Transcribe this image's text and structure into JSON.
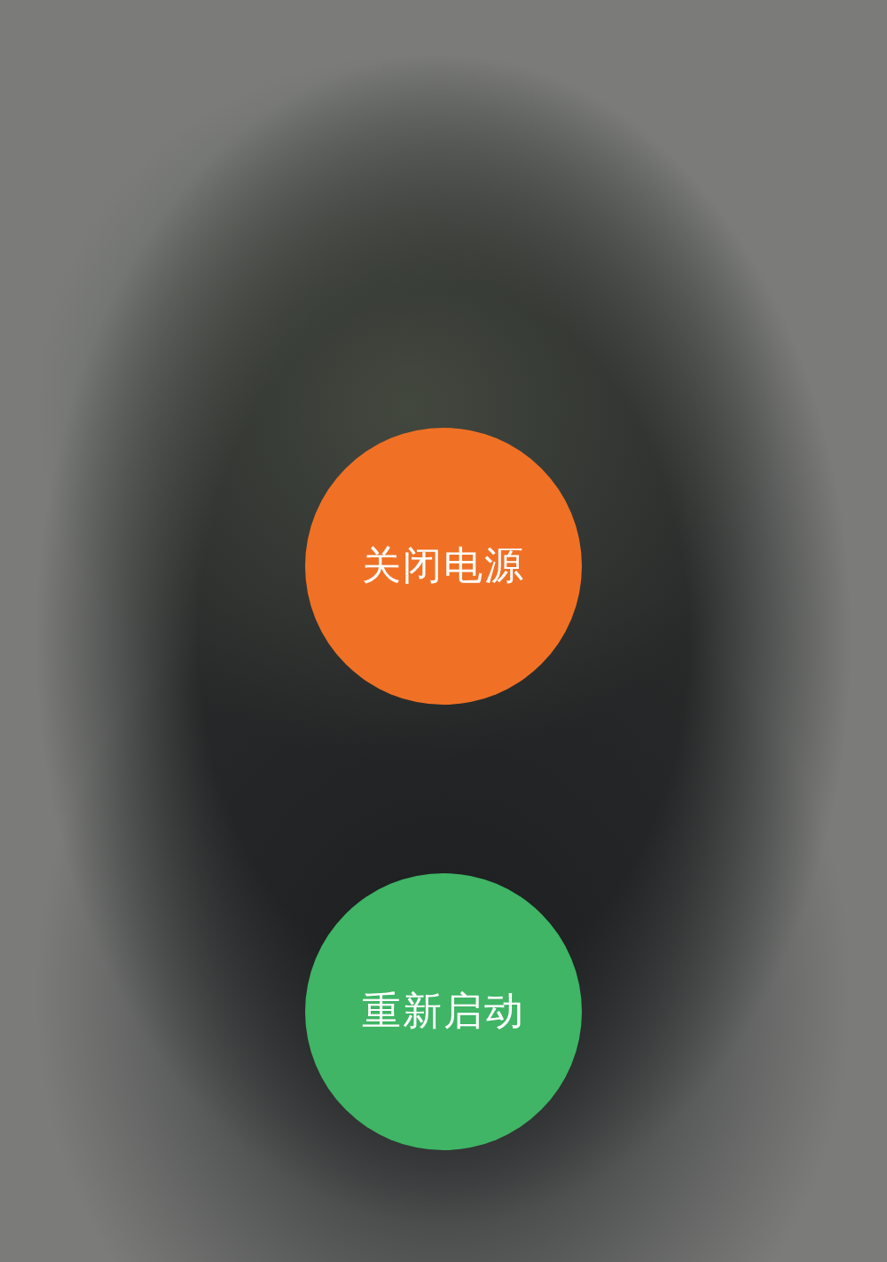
{
  "buttons": [
    {
      "kind": "power_off",
      "label": "关闭电源"
    },
    {
      "kind": "restart",
      "label": "重新启动"
    }
  ]
}
